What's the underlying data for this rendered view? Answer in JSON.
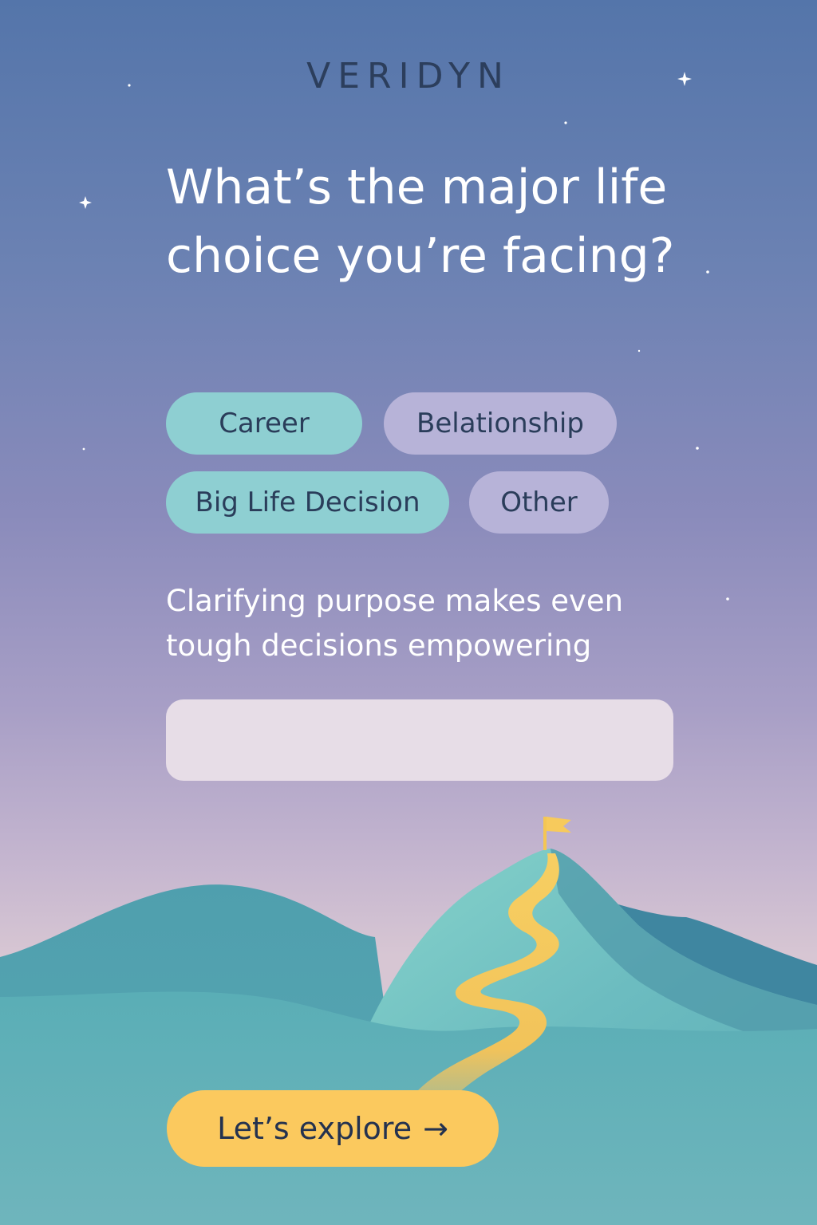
{
  "brand": "VERIDYN",
  "question": "What’s the major life choice you’re facing?",
  "options": [
    {
      "label": "Career",
      "tone": "teal"
    },
    {
      "label": "Belationship",
      "tone": "lavender"
    },
    {
      "label": "Big Life Decision",
      "tone": "teal"
    },
    {
      "label": "Other",
      "tone": "lavender"
    }
  ],
  "subtitle": "Clarifying purpose makes even tough decisions empowering",
  "input": {
    "value": "",
    "placeholder": ""
  },
  "cta": {
    "label": "Let’s explore",
    "arrow": "→"
  },
  "colors": {
    "sky_top": "#5475aa",
    "sky_bottom": "#d7c6d3",
    "chip_teal": "#8ecfd2",
    "chip_lavender": "#b7b3d8",
    "mountain": "#5fb3b8",
    "path": "#f5c85c",
    "cta": "#fbc95e",
    "text_dark": "#2a3d5a"
  },
  "icons": [
    "sparkle-icon",
    "flag-icon",
    "arrow-right-icon"
  ]
}
